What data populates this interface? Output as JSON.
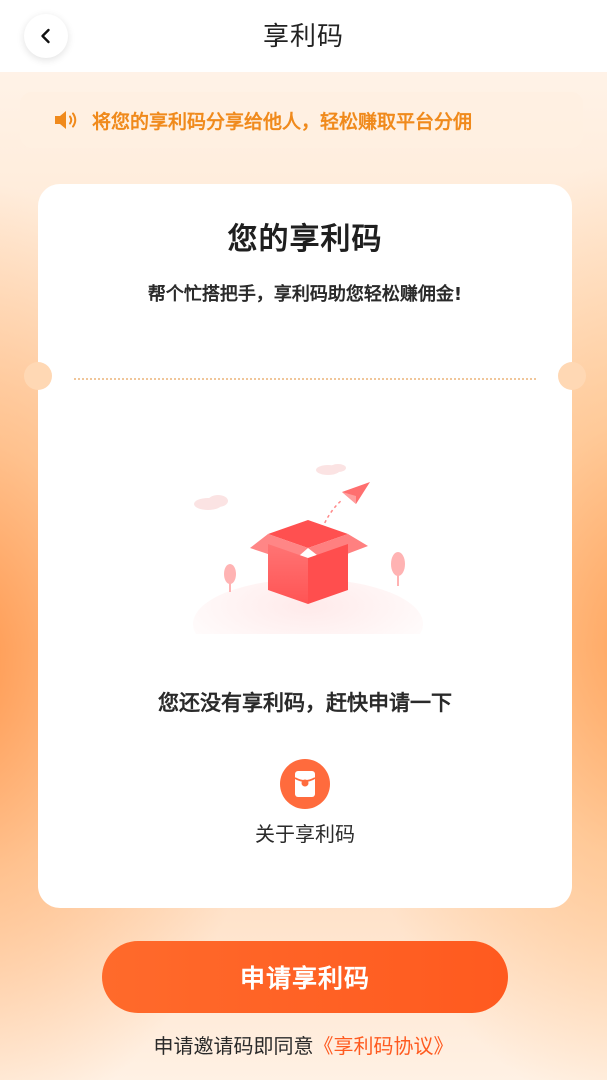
{
  "header": {
    "title": "享利码",
    "back_icon": "chevron-left-icon"
  },
  "notice": {
    "icon": "speaker-icon",
    "text": "将您的享利码分享给他人，轻松赚取平台分佣"
  },
  "card": {
    "title": "您的享利码",
    "subtitle": "帮个忙搭把手，享利码助您轻松赚佣金!",
    "illustration": "empty-box-illustration",
    "empty_text": "您还没有享利码，赶快申请一下",
    "about": {
      "icon": "red-envelope-icon",
      "label": "关于享利码"
    }
  },
  "apply_button": {
    "label": "申请享利码"
  },
  "agreement": {
    "prefix": "申请邀请码即同意",
    "link": "《享利码协议》"
  },
  "colors": {
    "accent": "#ff5a1f",
    "notice_text": "#f08a1c",
    "box": "#ff6b6b"
  }
}
